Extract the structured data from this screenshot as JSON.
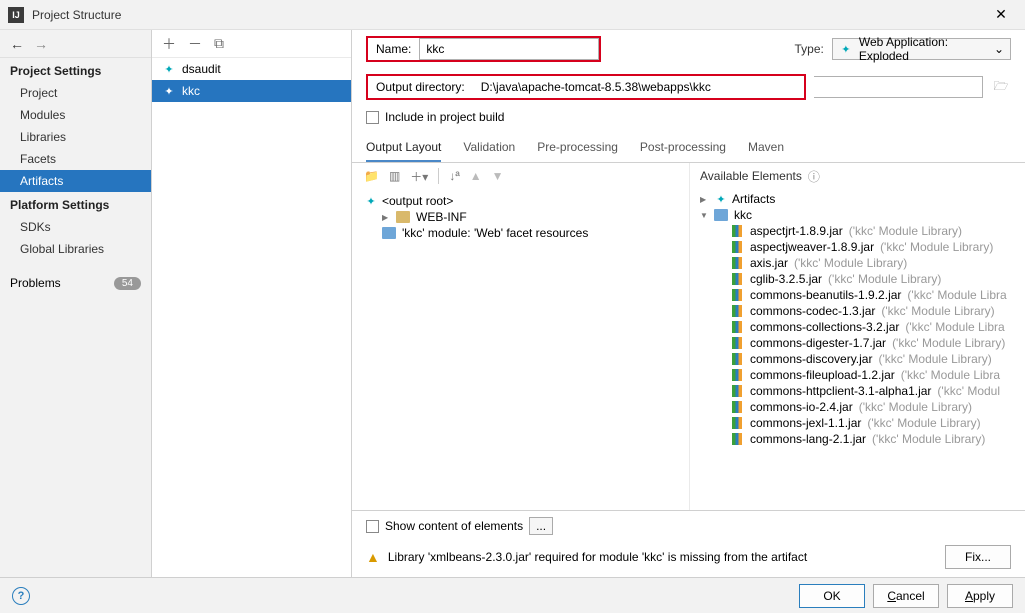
{
  "window": {
    "title": "Project Structure",
    "app_icon_letters": "IJ"
  },
  "nav": {
    "project_settings_label": "Project Settings",
    "project": "Project",
    "modules": "Modules",
    "libraries": "Libraries",
    "facets": "Facets",
    "artifacts": "Artifacts",
    "platform_settings_label": "Platform Settings",
    "sdks": "SDKs",
    "global_libraries": "Global Libraries",
    "problems": "Problems",
    "problems_count": "54"
  },
  "artifacts_list": {
    "items": [
      "dsaudit",
      "kkc"
    ],
    "selected": "kkc"
  },
  "form": {
    "name_label": "Name:",
    "name_value": "kkc",
    "type_label": "Type:",
    "type_value": "Web Application: Exploded",
    "output_label": "Output directory:",
    "output_value": "D:\\java\\apache-tomcat-8.5.38\\webapps\\kkc",
    "include_label": "Include in project build"
  },
  "tabs": {
    "output_layout": "Output Layout",
    "validation": "Validation",
    "preprocessing": "Pre-processing",
    "postprocessing": "Post-processing",
    "maven": "Maven"
  },
  "output_tree": {
    "root": "<output root>",
    "webinf": "WEB-INF",
    "facet": "'kkc' module: 'Web' facet resources"
  },
  "available": {
    "header": "Available Elements",
    "artifacts_node": "Artifacts",
    "module_node": "kkc",
    "libs": [
      {
        "name": "aspectjrt-1.8.9.jar",
        "meta": "('kkc' Module Library)"
      },
      {
        "name": "aspectjweaver-1.8.9.jar",
        "meta": "('kkc' Module Library)"
      },
      {
        "name": "axis.jar",
        "meta": "('kkc' Module Library)"
      },
      {
        "name": "cglib-3.2.5.jar",
        "meta": "('kkc' Module Library)"
      },
      {
        "name": "commons-beanutils-1.9.2.jar",
        "meta": "('kkc' Module Libra"
      },
      {
        "name": "commons-codec-1.3.jar",
        "meta": "('kkc' Module Library)"
      },
      {
        "name": "commons-collections-3.2.jar",
        "meta": "('kkc' Module Libra"
      },
      {
        "name": "commons-digester-1.7.jar",
        "meta": "('kkc' Module Library)"
      },
      {
        "name": "commons-discovery.jar",
        "meta": "('kkc' Module Library)"
      },
      {
        "name": "commons-fileupload-1.2.jar",
        "meta": "('kkc' Module Libra"
      },
      {
        "name": "commons-httpclient-3.1-alpha1.jar",
        "meta": "('kkc' Modul"
      },
      {
        "name": "commons-io-2.4.jar",
        "meta": "('kkc' Module Library)"
      },
      {
        "name": "commons-jexl-1.1.jar",
        "meta": "('kkc' Module Library)"
      },
      {
        "name": "commons-lang-2.1.jar",
        "meta": "('kkc' Module Library)"
      }
    ]
  },
  "footer": {
    "show_content": "Show content of elements",
    "dots": "...",
    "warning": "Library 'xmlbeans-2.3.0.jar' required for module 'kkc' is missing from the artifact",
    "fix": "Fix..."
  },
  "buttons": {
    "ok": "OK",
    "cancel": "Cancel",
    "apply": "Apply",
    "cancel_ul": "C",
    "apply_ul": "A"
  }
}
